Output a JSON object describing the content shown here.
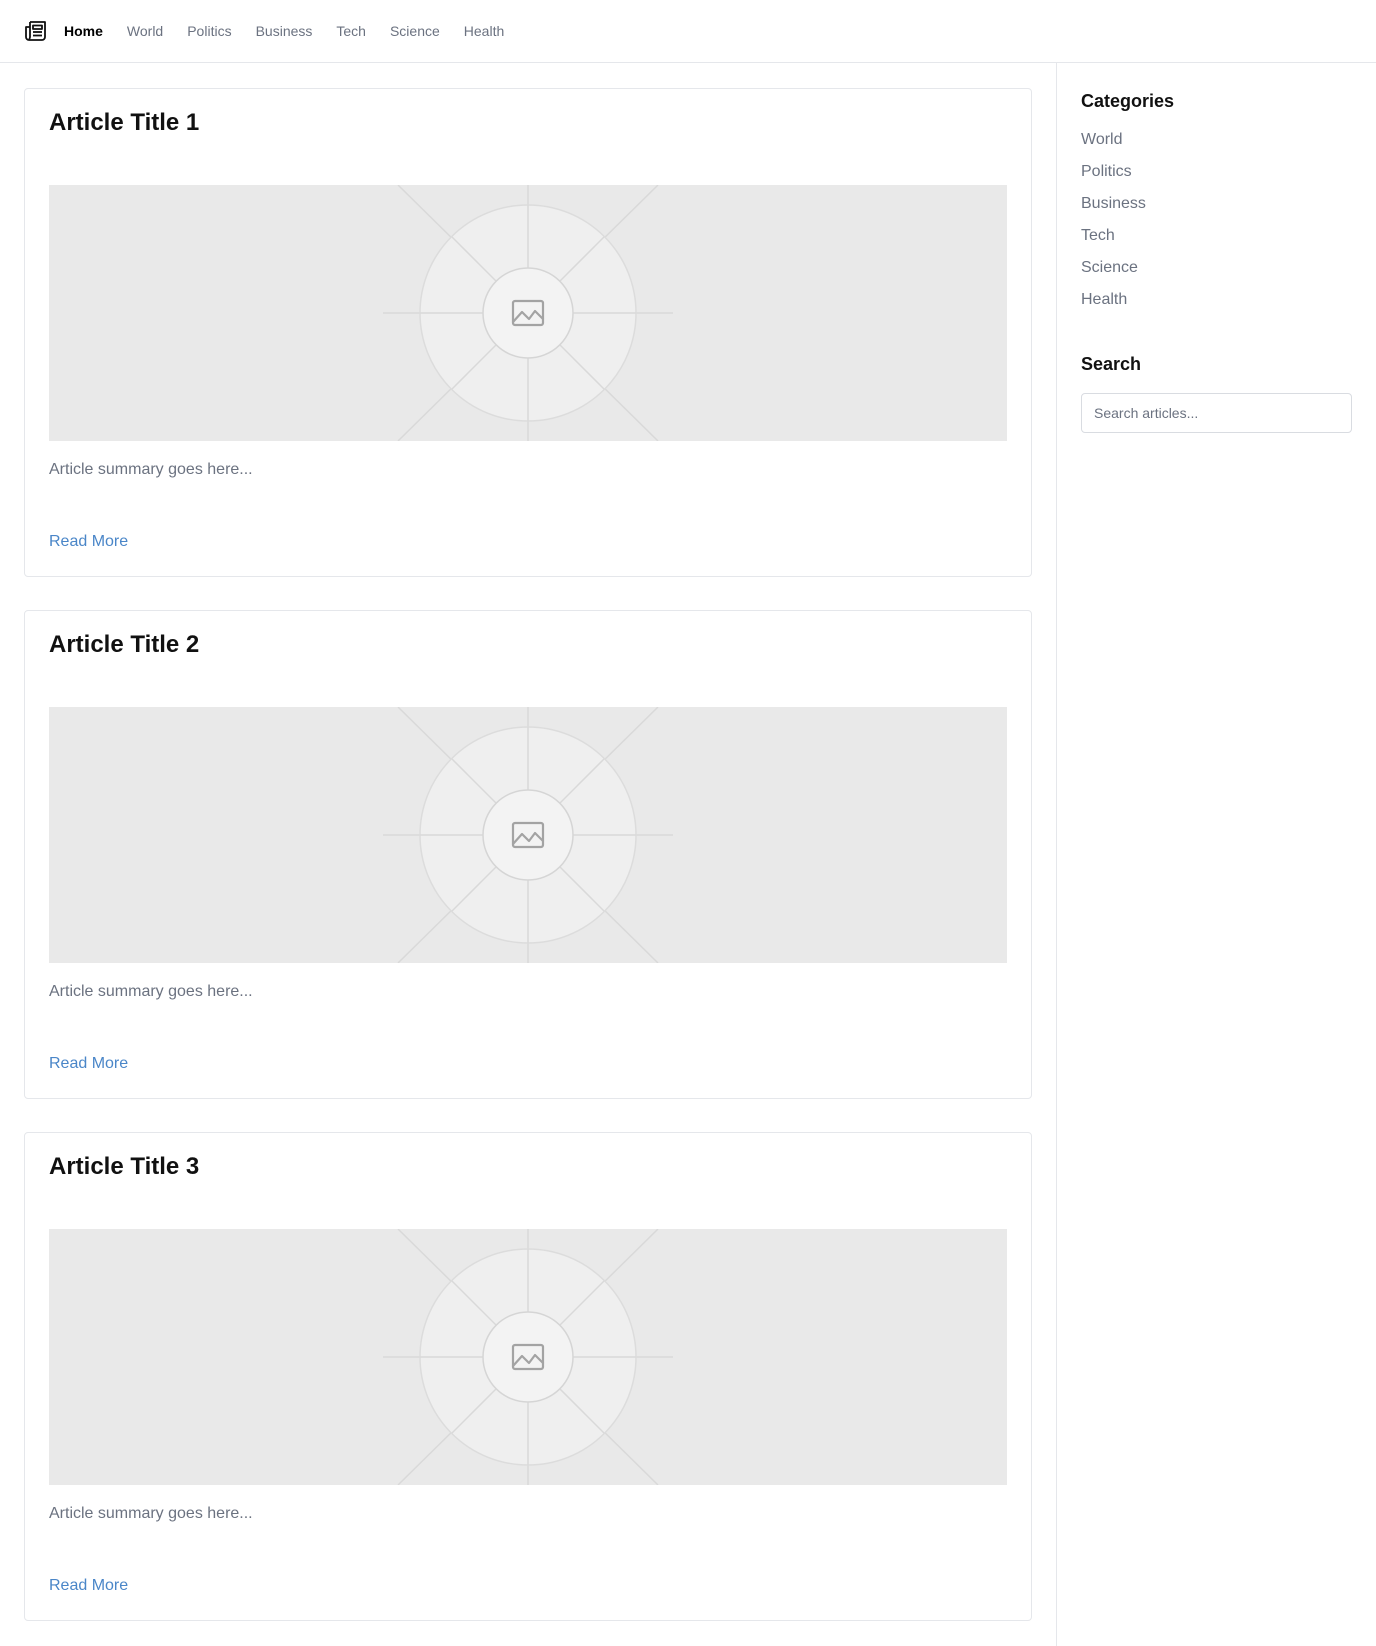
{
  "header": {
    "logo_icon": "newspaper-icon",
    "nav": [
      {
        "label": "Home",
        "active": true
      },
      {
        "label": "World"
      },
      {
        "label": "Politics"
      },
      {
        "label": "Business"
      },
      {
        "label": "Tech"
      },
      {
        "label": "Science"
      },
      {
        "label": "Health"
      }
    ]
  },
  "articles": [
    {
      "title": "Article Title 1",
      "summary": "Article summary goes here...",
      "link": "Read More",
      "image_icon": "image-placeholder-icon"
    },
    {
      "title": "Article Title 2",
      "summary": "Article summary goes here...",
      "link": "Read More",
      "image_icon": "image-placeholder-icon"
    },
    {
      "title": "Article Title 3",
      "summary": "Article summary goes here...",
      "link": "Read More",
      "image_icon": "image-placeholder-icon"
    }
  ],
  "sidebar": {
    "categories_heading": "Categories",
    "categories": [
      "World",
      "Politics",
      "Business",
      "Tech",
      "Science",
      "Health"
    ],
    "search_heading": "Search",
    "search_placeholder": "Search articles..."
  },
  "colors": {
    "link": "#4a86c8",
    "muted_text": "#6b7280",
    "border": "#e5e7eb",
    "image_bg": "#e9e9e9"
  }
}
